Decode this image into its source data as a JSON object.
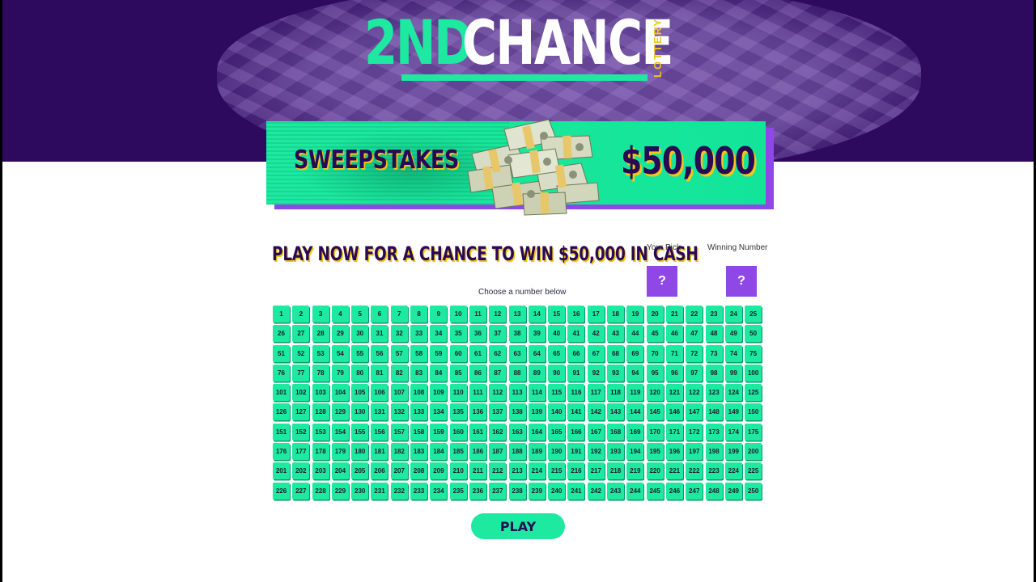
{
  "logo": {
    "part1": "2ND",
    "part2": "CHANCE",
    "tagline": "LOTTERY"
  },
  "banner": {
    "label": "SWEEPSTAKES",
    "prize": "$50,000"
  },
  "heading": "PLAY NOW FOR A CHANCE TO WIN $50,000 IN CASH",
  "your_pick": {
    "label": "Your Pick",
    "value": "?"
  },
  "winning_number": {
    "label": "Winning Number",
    "value": "?"
  },
  "choose_label": "Choose a number below",
  "number_grid": {
    "min": 1,
    "max": 250,
    "columns": 25
  },
  "play_button": "PLAY",
  "colors": {
    "header_purple": "#2e0a5e",
    "accent_green": "#1de9a0",
    "accent_violet": "#8f47e6",
    "gold": "#f5c518"
  }
}
